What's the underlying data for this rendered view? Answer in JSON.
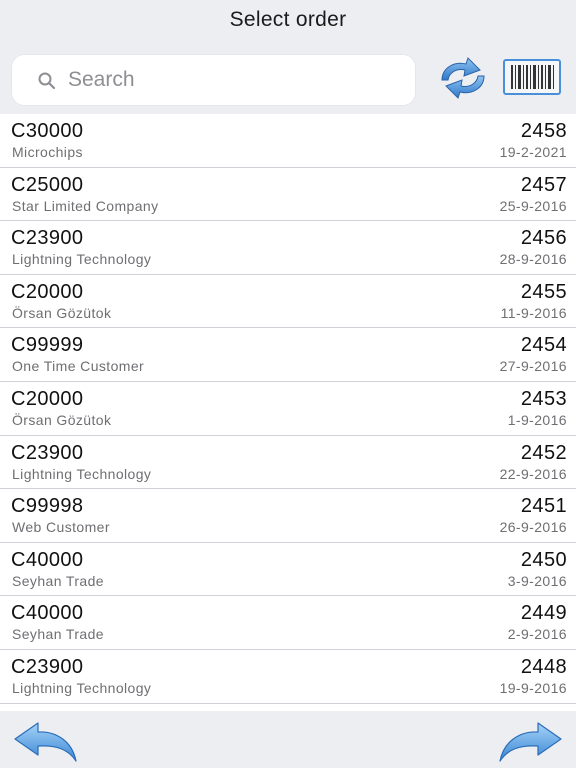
{
  "header": {
    "title": "Select order",
    "search_placeholder": "Search",
    "icons": {
      "search": "search-icon",
      "refresh": "refresh-icon",
      "barcode": "barcode-icon"
    }
  },
  "orders": [
    {
      "code": "C30000",
      "customer": "Microchips",
      "number": "2458",
      "date": "19-2-2021"
    },
    {
      "code": "C25000",
      "customer": "Star Limited Company",
      "number": "2457",
      "date": "25-9-2016"
    },
    {
      "code": "C23900",
      "customer": "Lightning Technology",
      "number": "2456",
      "date": "28-9-2016"
    },
    {
      "code": "C20000",
      "customer": "Örsan Gözütok",
      "number": "2455",
      "date": "11-9-2016"
    },
    {
      "code": "C99999",
      "customer": "One Time Customer",
      "number": "2454",
      "date": "27-9-2016"
    },
    {
      "code": "C20000",
      "customer": "Örsan Gözütok",
      "number": "2453",
      "date": "1-9-2016"
    },
    {
      "code": "C23900",
      "customer": "Lightning Technology",
      "number": "2452",
      "date": "22-9-2016"
    },
    {
      "code": "C99998",
      "customer": "Web Customer",
      "number": "2451",
      "date": "26-9-2016"
    },
    {
      "code": "C40000",
      "customer": "Seyhan Trade",
      "number": "2450",
      "date": "3-9-2016"
    },
    {
      "code": "C40000",
      "customer": "Seyhan Trade",
      "number": "2449",
      "date": "2-9-2016"
    },
    {
      "code": "C23900",
      "customer": "Lightning Technology",
      "number": "2448",
      "date": "19-9-2016"
    }
  ],
  "footer": {
    "icons": {
      "back": "back-arrow-icon",
      "forward": "forward-arrow-icon"
    }
  },
  "colors": {
    "bar_background": "#eceef1",
    "icon_blue": "#4a90d9",
    "divider": "#cfd2d6"
  }
}
